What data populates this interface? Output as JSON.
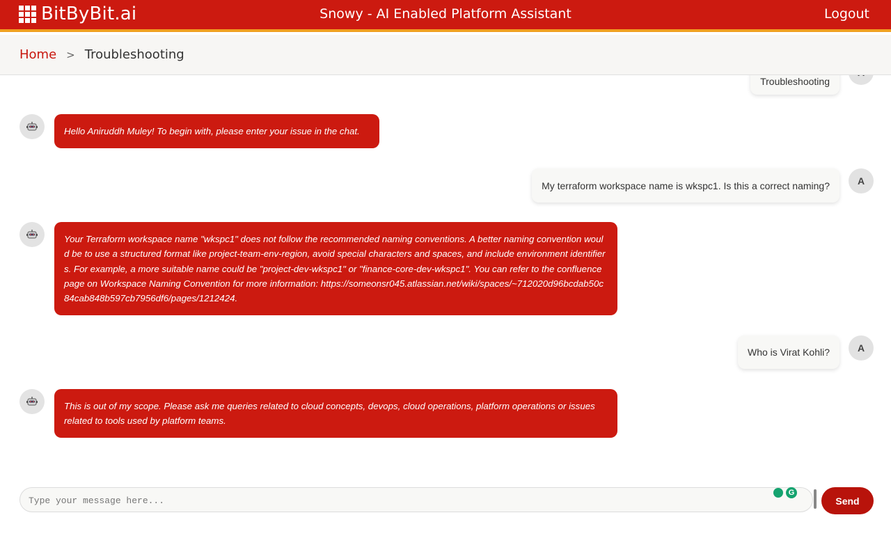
{
  "header": {
    "brand": "BitByBit.ai",
    "title": "Snowy - AI Enabled Platform Assistant",
    "logout_label": "Logout"
  },
  "breadcrumb": {
    "home": "Home",
    "separator": ">",
    "current": "Troubleshooting"
  },
  "messages": [
    {
      "role": "user",
      "text": "Troubleshooting",
      "avatar": "A"
    },
    {
      "role": "bot",
      "text": "Hello Aniruddh Muley! To begin with, please enter your issue in the chat."
    },
    {
      "role": "user",
      "text": "My terraform workspace name is wkspc1. Is this a correct naming?",
      "avatar": "A"
    },
    {
      "role": "bot",
      "text": "Your Terraform workspace name \"wkspc1\" does not follow the recommended naming conventions. A better naming convention would be to use a structured format like project-team-env-region, avoid special characters and spaces, and include environment identifiers. For example, a more suitable name could be \"project-dev-wkspc1\" or \"finance-core-dev-wkspc1\". You can refer to the confluence page on Workspace Naming Convention for more information: https://someonsr045.atlassian.net/wiki/spaces/~712020d96bcdab50c84cab848b597cb7956df6/pages/1212424."
    },
    {
      "role": "user",
      "text": "Who is Virat Kohli?",
      "avatar": "A"
    },
    {
      "role": "bot",
      "text": "This is out of my scope. Please ask me queries related to cloud concepts, devops, cloud operations, platform operations or issues related to tools used by platform teams."
    }
  ],
  "composer": {
    "placeholder": "Type your message here...",
    "send_label": "Send"
  },
  "colors": {
    "brand_red": "#cc1a10",
    "accent_orange": "#f0a020",
    "grammarly_green": "#15a36f"
  },
  "icons": {
    "brand": "grid-logo-icon",
    "bot": "robot-icon",
    "grammarly": "grammarly-icon"
  }
}
